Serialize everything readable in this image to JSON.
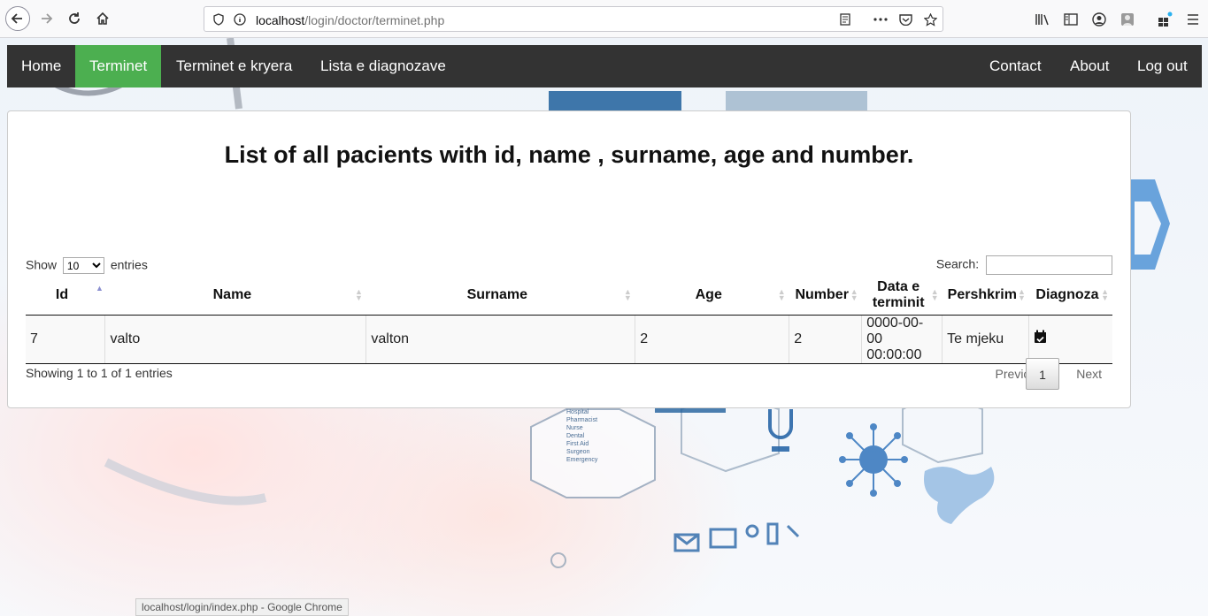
{
  "browser": {
    "url_host": "localhost",
    "url_path": "/login/doctor/terminet.php",
    "status_text": "localhost/login/index.php - Google Chrome"
  },
  "nav": {
    "left": [
      "Home",
      "Terminet",
      "Terminet e kryera",
      "Lista e diagnozave"
    ],
    "right": [
      "Contact",
      "About",
      "Log out"
    ],
    "active": "Terminet",
    "active_color": "#4caf50",
    "bar_color": "#333333"
  },
  "page": {
    "title": "List of all pacients with id, name , surname, age and number."
  },
  "table": {
    "show_label": "Show",
    "entries_label": "entries",
    "page_length": "10",
    "search_label": "Search:",
    "search_value": "",
    "columns": [
      "Id",
      "Name",
      "Surname",
      "Age",
      "Number",
      "Data e terminit",
      "Pershkrim",
      "Diagnoza"
    ],
    "sorted_column": "Id",
    "rows": [
      {
        "id": "7",
        "name": "valto",
        "surname": "valton",
        "age": "2",
        "number": "2",
        "data": "0000-00-00 00:00:00",
        "pershkrim": "Te mjeku",
        "diagnoza_icon": "calendar-check-icon"
      }
    ],
    "info": "Showing 1 to 1 of 1 entries",
    "previous": "Previous",
    "current_page": "1",
    "next": "Next"
  }
}
